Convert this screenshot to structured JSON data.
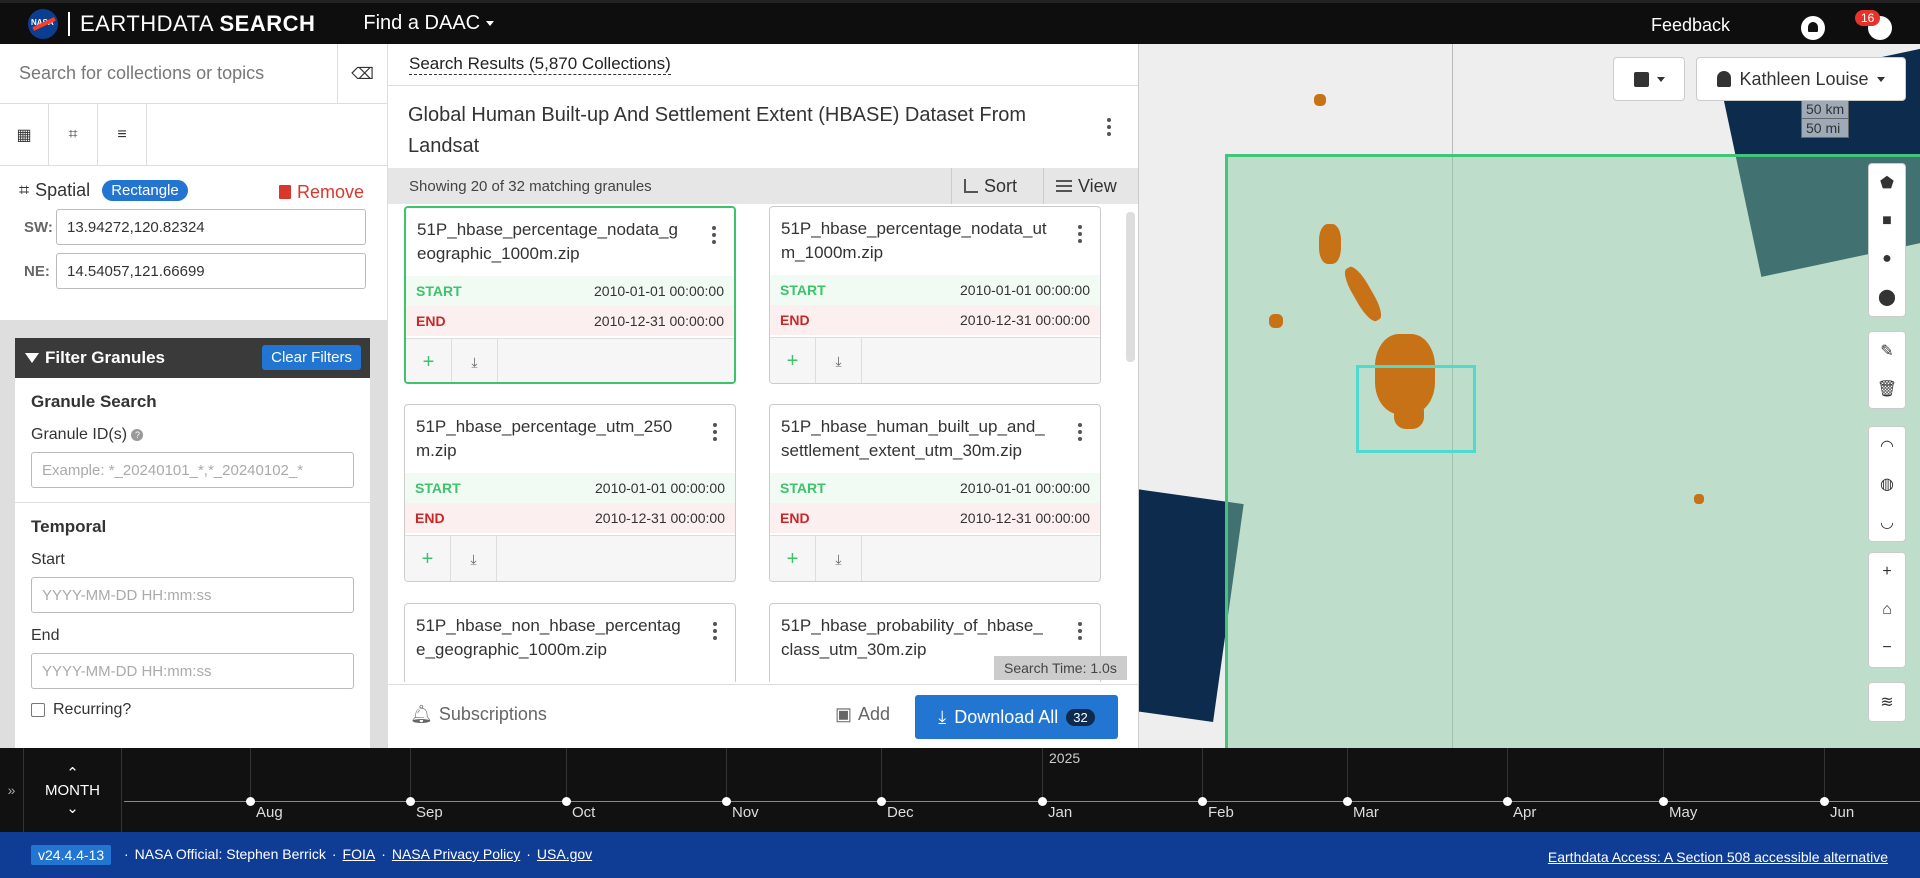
{
  "header": {
    "logo_text": "NASA",
    "brand_light": "EARTHDATA",
    "brand_bold": "SEARCH",
    "find_daac": "Find a DAAC",
    "feedback": "Feedback",
    "notification_count": "16"
  },
  "sidebar": {
    "search_placeholder": "Search for collections or topics",
    "spatial": {
      "title": "Spatial",
      "type_chip": "Rectangle",
      "remove": "Remove",
      "sw_label": "SW:",
      "sw_value": "13.94272,120.82324",
      "ne_label": "NE:",
      "ne_value": "14.54057,121.66699"
    },
    "filter": {
      "title": "Filter Granules",
      "clear": "Clear Filters",
      "granule_search": "Granule Search",
      "granule_ids_label": "Granule ID(s)",
      "granule_ids_placeholder": "Example: *_20240101_*,*_20240102_*",
      "temporal": "Temporal",
      "start_label": "Start",
      "start_placeholder": "YYYY-MM-DD HH:mm:ss",
      "end_label": "End",
      "end_placeholder": "YYYY-MM-DD HH:mm:ss",
      "recurring": "Recurring?"
    }
  },
  "results": {
    "header": "Search Results (5,870 Collections)",
    "collection_title": "Global Human Built-up And Settlement Extent (HBASE) Dataset From Landsat",
    "showing": "Showing 20 of 32 matching granules",
    "sort": "Sort",
    "view": "View",
    "start_label": "START",
    "end_label": "END",
    "granules": [
      {
        "name": "51P_hbase_percentage_nodata_geographic_1000m.zip",
        "start": "2010-01-01 00:00:00",
        "end": "2010-12-31 00:00:00"
      },
      {
        "name": "51P_hbase_percentage_nodata_utm_1000m.zip",
        "start": "2010-01-01 00:00:00",
        "end": "2010-12-31 00:00:00"
      },
      {
        "name": "51P_hbase_percentage_utm_250m.zip",
        "start": "2010-01-01 00:00:00",
        "end": "2010-12-31 00:00:00"
      },
      {
        "name": "51P_hbase_human_built_up_and_settlement_extent_utm_30m.zip",
        "start": "2010-01-01 00:00:00",
        "end": "2010-12-31 00:00:00"
      },
      {
        "name": "51P_hbase_non_hbase_percentage_geographic_1000m.zip",
        "start": "",
        "end": ""
      },
      {
        "name": "51P_hbase_probability_of_hbase_class_utm_30m.zip",
        "start": "",
        "end": ""
      }
    ],
    "search_time": "Search Time: 1.0s",
    "subscriptions": "Subscriptions",
    "add": "Add",
    "download_all": "Download All",
    "download_count": "32"
  },
  "map": {
    "user": "Kathleen Louise",
    "scale_km": "50 km",
    "scale_mi": "50 mi"
  },
  "timeline": {
    "zoom_label": "MONTH",
    "year": "2025",
    "months": [
      "Aug",
      "Sep",
      "Oct",
      "Nov",
      "Dec",
      "Jan",
      "Feb",
      "Mar",
      "Apr",
      "May",
      "Jun"
    ]
  },
  "footer": {
    "version": "v24.4.4-13",
    "official": "NASA Official: Stephen Berrick",
    "foia": "FOIA",
    "privacy": "NASA Privacy Policy",
    "usagov": "USA.gov",
    "access": "Earthdata Access: A Section 508 accessible alternative"
  }
}
